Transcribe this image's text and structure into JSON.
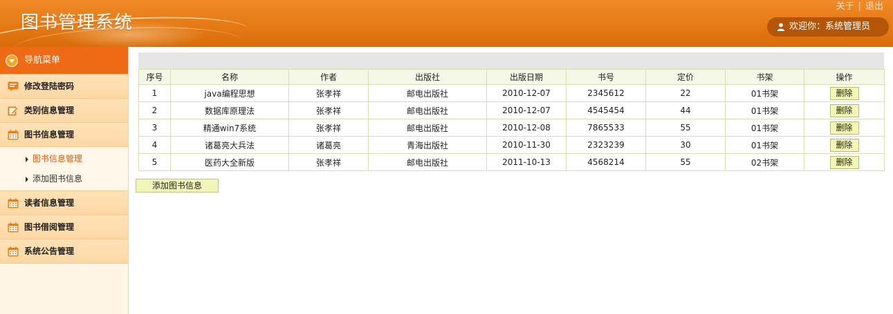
{
  "header": {
    "app_title": "图书管理系统",
    "links": {
      "about": "关于",
      "logout": "退出"
    },
    "welcome": "欢迎你：系统管理员"
  },
  "sidebar": {
    "nav_title": "导航菜单",
    "items": [
      {
        "label": "修改登陆密码",
        "icon": "edit-note-icon"
      },
      {
        "label": "类别信息管理",
        "icon": "edit-pencil-icon"
      },
      {
        "label": "图书信息管理",
        "icon": "calendar-icon"
      },
      {
        "label": "读者信息管理",
        "icon": "calendar-icon"
      },
      {
        "label": "图书借阅管理",
        "icon": "calendar-icon"
      },
      {
        "label": "系统公告管理",
        "icon": "calendar-icon"
      }
    ],
    "sub_items": [
      {
        "label": "图书信息管理",
        "active": true
      },
      {
        "label": "添加图书信息",
        "active": false
      }
    ]
  },
  "table": {
    "headers": [
      "序号",
      "名称",
      "作者",
      "出版社",
      "出版日期",
      "书号",
      "定价",
      "书架",
      "操作"
    ],
    "rows": [
      [
        "1",
        "java编程思想",
        "张孝祥",
        "邮电出版社",
        "2010-12-07",
        "2345612",
        "22",
        "01书架"
      ],
      [
        "2",
        "数据库原理法",
        "张孝祥",
        "邮电出版社",
        "2010-12-07",
        "4545454",
        "44",
        "01书架"
      ],
      [
        "3",
        "精通win7系统",
        "张孝祥",
        "邮电出版社",
        "2010-12-08",
        "7865533",
        "55",
        "01书架"
      ],
      [
        "4",
        "诸葛亮大兵法",
        "诸葛亮",
        "青海出版社",
        "2010-11-30",
        "2323239",
        "30",
        "01书架"
      ],
      [
        "5",
        "医药大全新版",
        "张孝祥",
        "邮电出版社",
        "2011-10-13",
        "4568214",
        "55",
        "02书架"
      ]
    ],
    "delete_label": "删除"
  },
  "add_button": "添加图书信息",
  "colors": {
    "header_orange": "#e57a14",
    "nav_title_bg": "#ef6a15",
    "menu_bg": "#fdd8a4",
    "active_sub": "#e0590c",
    "button_bg": "#f3f6b2"
  }
}
